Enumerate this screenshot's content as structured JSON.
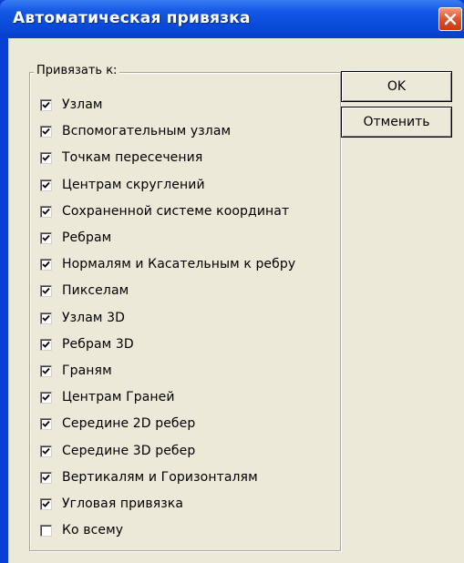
{
  "window": {
    "title": "Автоматическая привязка"
  },
  "group": {
    "legend": "Привязать к:"
  },
  "options": [
    {
      "label": "Узлам",
      "checked": true
    },
    {
      "label": "Вспомогательным узлам",
      "checked": true
    },
    {
      "label": "Точкам пересечения",
      "checked": true
    },
    {
      "label": "Центрам скруглений",
      "checked": true
    },
    {
      "label": "Сохраненной системе координат",
      "checked": true
    },
    {
      "label": "Ребрам",
      "checked": true
    },
    {
      "label": "Нормалям и Касательным к ребру",
      "checked": true
    },
    {
      "label": "Пикселам",
      "checked": true
    },
    {
      "label": "Узлам 3D",
      "checked": true
    },
    {
      "label": "Ребрам 3D",
      "checked": true
    },
    {
      "label": "Граням",
      "checked": true
    },
    {
      "label": "Центрам Граней",
      "checked": true
    },
    {
      "label": "Середине 2D ребер",
      "checked": true
    },
    {
      "label": "Середине 3D ребер",
      "checked": true
    },
    {
      "label": "Вертикалям и Горизонталям",
      "checked": true
    },
    {
      "label": "Угловая привязка",
      "checked": true
    },
    {
      "label": "Ко всему",
      "checked": false
    }
  ],
  "buttons": {
    "ok_label": "OK",
    "cancel_label": "Отменить"
  },
  "icons": {
    "close": "close-icon",
    "check": "checkmark-icon"
  },
  "colors": {
    "titlebar": "#0a49d8",
    "client_bg": "#ece9d8",
    "close_button": "#e0502a"
  }
}
